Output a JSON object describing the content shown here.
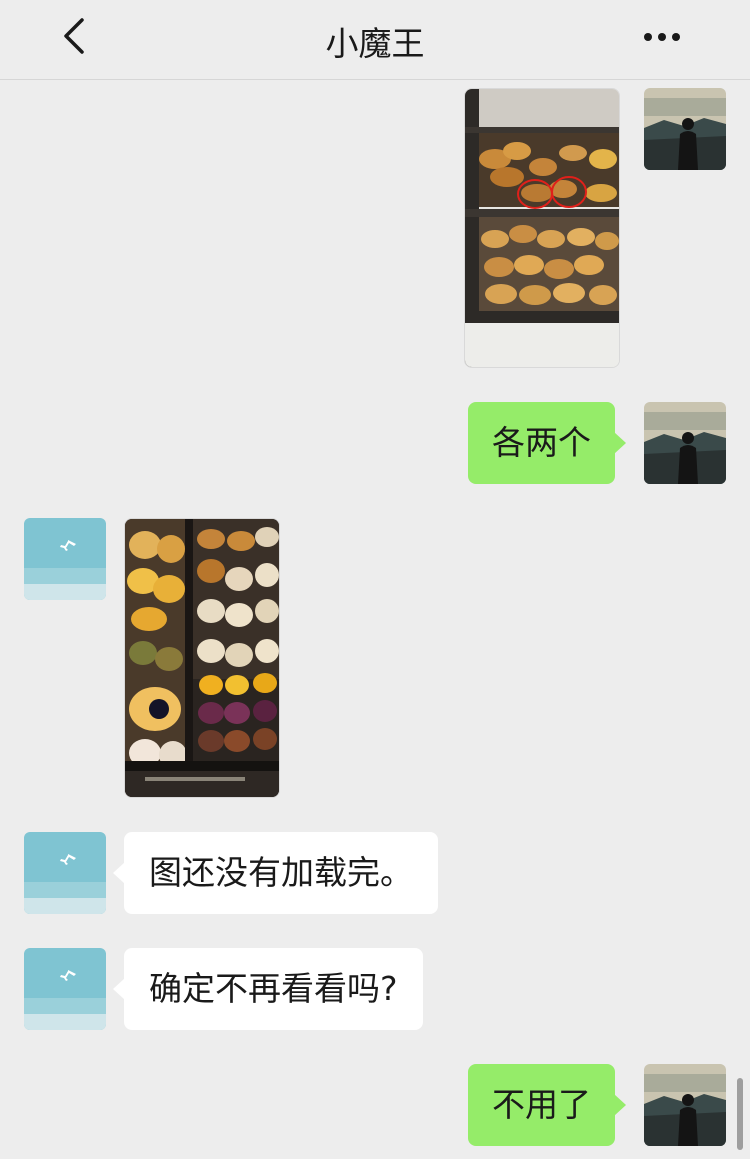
{
  "header": {
    "title": "小魔王",
    "back_icon": "chevron-left-icon",
    "more_icon": "more-dots-icon"
  },
  "messages": [
    {
      "side": "right",
      "kind": "image",
      "content": "bakery-shelf-photo"
    },
    {
      "side": "right",
      "kind": "text",
      "text": "各两个"
    },
    {
      "side": "left",
      "kind": "image",
      "content": "pastry-display-photo"
    },
    {
      "side": "left",
      "kind": "text",
      "text": "图还没有加载完。"
    },
    {
      "side": "left",
      "kind": "text",
      "text": "确定不再看看吗?"
    },
    {
      "side": "right",
      "kind": "text",
      "text": "不用了"
    }
  ],
  "colors": {
    "background": "#ededed",
    "outgoing_bubble": "#95ec69",
    "incoming_bubble": "#ffffff"
  }
}
